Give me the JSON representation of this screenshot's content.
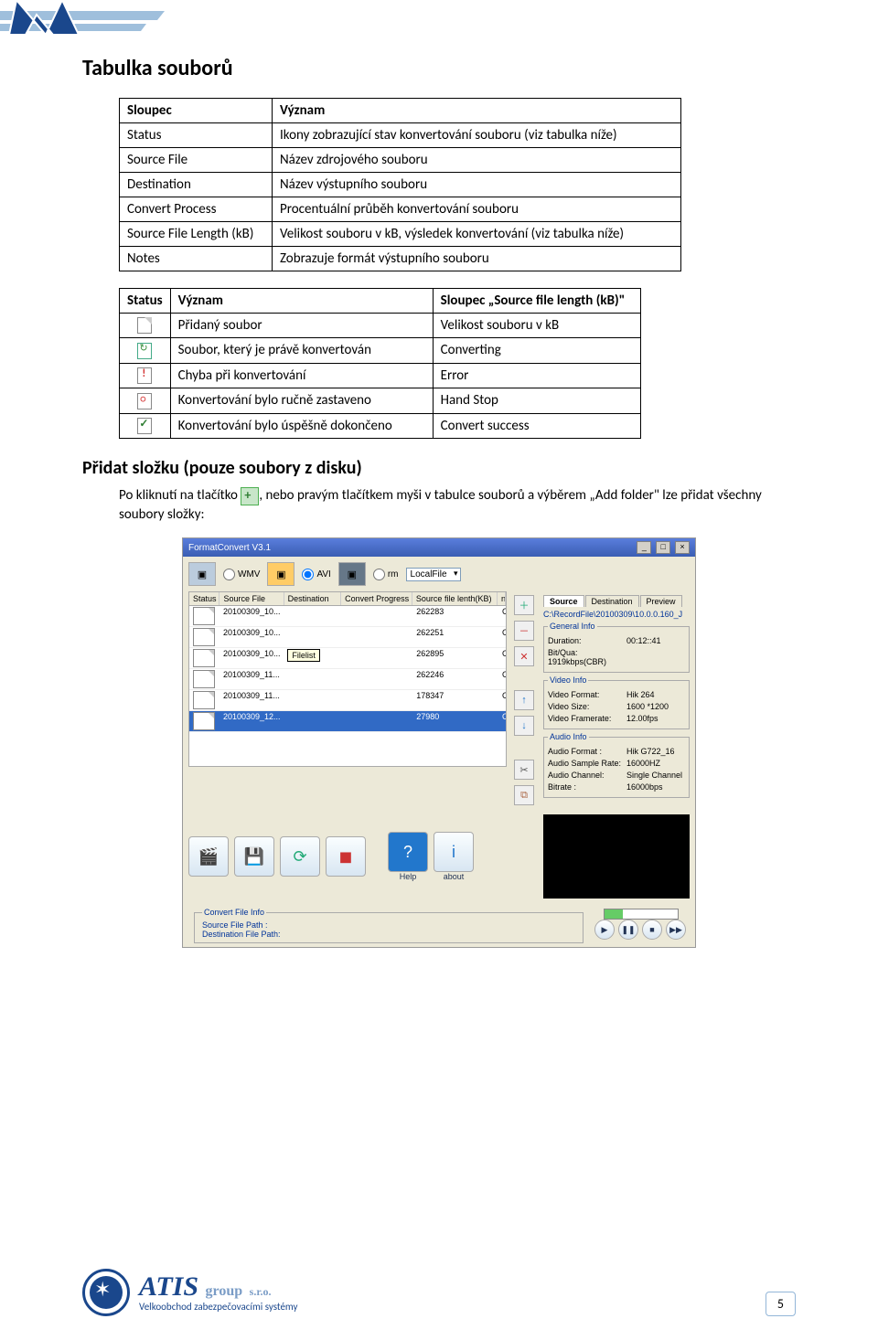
{
  "page_number": "5",
  "headings": {
    "main": "Tabulka souborů",
    "add_folder": "Přidat složku (pouze soubory z disku)"
  },
  "table1": {
    "h1": "Sloupec",
    "h2": "Význam",
    "rows": [
      {
        "a": "Status",
        "b": "Ikony zobrazující stav konvertování souboru (viz tabulka níže)"
      },
      {
        "a": "Source File",
        "b": "Název zdrojového souboru"
      },
      {
        "a": "Destination",
        "b": "Název výstupního souboru"
      },
      {
        "a": "Convert Process",
        "b": "Procentuální průběh konvertování souboru"
      },
      {
        "a": "Source File Length (kB)",
        "b": "Velikost souboru v kB, výsledek konvertování (viz tabulka níže)"
      },
      {
        "a": "Notes",
        "b": "Zobrazuje formát výstupního souboru"
      }
    ]
  },
  "table2": {
    "h1": "Status",
    "h2": "Význam",
    "h3": "Sloupec „Source file length (kB)\"",
    "rows": [
      {
        "ic": "new",
        "b": "Přidaný soubor",
        "c": "Velikost souboru v kB"
      },
      {
        "ic": "conv",
        "b": "Soubor, který je právě konvertován",
        "c": "Converting"
      },
      {
        "ic": "err",
        "b": "Chyba při konvertování",
        "c": "Error"
      },
      {
        "ic": "stop",
        "b": "Konvertování bylo ručně zastaveno",
        "c": "Hand Stop"
      },
      {
        "ic": "ok",
        "b": "Konvertování bylo úspěšně dokončeno",
        "c": "Convert success"
      }
    ]
  },
  "paragraph": {
    "before": "Po kliknutí na tlačítko ",
    "after": ", nebo pravým tlačítkem myši v tabulce souborů a výběrem „Add folder\" lze přidat všechny soubory složky:"
  },
  "app": {
    "title": "FormatConvert V3.1",
    "toolbar": {
      "wmv": "WMV",
      "avi": "AVI",
      "rm": "rm",
      "combo": "LocalFile"
    },
    "grid": {
      "hdr": {
        "status": "Status",
        "sf": "Source File",
        "ds": "Destination",
        "cp": "Convert Progress",
        "ln": "Source file lenth(KB)",
        "nt": "notes"
      },
      "rows": [
        {
          "sf": "20100309_10...",
          "ds": "",
          "ln": "262283",
          "nt": "Convert To AVI"
        },
        {
          "sf": "20100309_10...",
          "ds": "",
          "ln": "262251",
          "nt": "Convert To AVI"
        },
        {
          "sf": "20100309_10...",
          "ds": "Filelist",
          "ln": "262895",
          "nt": "Convert To AVI"
        },
        {
          "sf": "20100309_11...",
          "ds": "",
          "ln": "262246",
          "nt": "Convert To AVI"
        },
        {
          "sf": "20100309_11...",
          "ds": "",
          "ln": "178347",
          "nt": "Convert To AVI"
        },
        {
          "sf": "20100309_12...",
          "ds": "",
          "ln": "27980",
          "nt": "Convert To AVI",
          "sel": true
        }
      ],
      "tooltip": "Filelist"
    },
    "info": {
      "tabs": {
        "source": "Source",
        "dest": "Destination",
        "prev": "Preview"
      },
      "path": "C:\\RecordFile\\20100309\\10.0.0.160_J",
      "general": {
        "legend": "General Info",
        "duration_l": "Duration:",
        "duration": "00:12::41",
        "bit_l": "Bit/Qua:",
        "bit": "1919kbps(CBR)"
      },
      "video": {
        "legend": "Video Info",
        "f_l": "Video Format:",
        "f": "Hik 264",
        "s_l": "Video Size:",
        "s": "1600 *1200",
        "r_l": "Video Framerate:",
        "r": "12.00fps"
      },
      "audio": {
        "legend": "Audio Info",
        "f_l": "Audio Format :",
        "f": "Hik G722_16",
        "sr_l": "Audio Sample Rate:",
        "sr": "16000HZ",
        "ch_l": "Audio Channel:",
        "ch": "Single Channel",
        "br_l": "Bitrate :",
        "br": "16000bps"
      }
    },
    "bottom": {
      "help": "Help",
      "about": "about",
      "conv_legend": "Convert File Info",
      "src": "Source File Path :",
      "dst": "Destination File Path:"
    }
  },
  "footer": {
    "brand": "ATIS",
    "suffix": "group",
    "sro": "s.r.o.",
    "tagline": "Velkoobchod zabezpečovacími systémy"
  }
}
